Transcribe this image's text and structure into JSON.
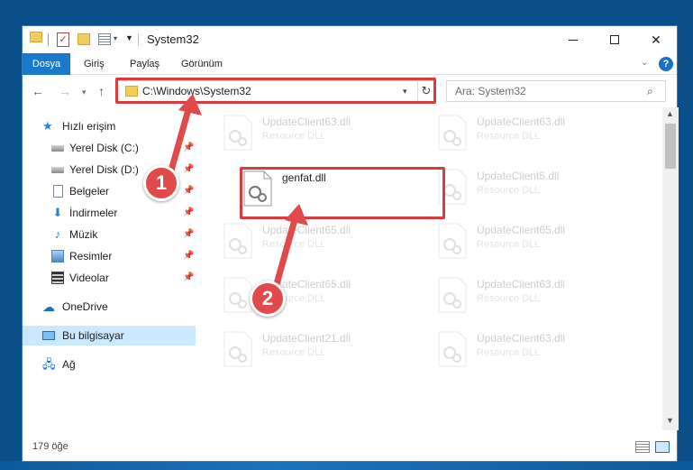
{
  "window": {
    "title": "System32",
    "controls": {
      "minimize": "minimize",
      "maximize": "maximize",
      "close": "close"
    }
  },
  "ribbon": {
    "tabs": [
      {
        "label": "Dosya",
        "active": true
      },
      {
        "label": "Giriş"
      },
      {
        "label": "Paylaş"
      },
      {
        "label": "Görünüm"
      }
    ],
    "help": "?"
  },
  "address": {
    "path": "C:\\Windows\\System32",
    "search_placeholder": "Ara: System32"
  },
  "navpane": {
    "items": [
      {
        "label": "Hızlı erişim",
        "icon": "star-icon"
      },
      {
        "label": "Yerel Disk (C:)",
        "icon": "drive-icon",
        "pinned": true
      },
      {
        "label": "Yerel Disk (D:)",
        "icon": "drive-icon",
        "pinned": true
      },
      {
        "label": "Belgeler",
        "icon": "documents-icon",
        "pinned": true
      },
      {
        "label": "İndirmeler",
        "icon": "download-icon",
        "pinned": true
      },
      {
        "label": "Müzik",
        "icon": "music-icon",
        "pinned": true
      },
      {
        "label": "Resimler",
        "icon": "pictures-icon",
        "pinned": true
      },
      {
        "label": "Videolar",
        "icon": "videos-icon",
        "pinned": true
      },
      {
        "label": "OneDrive",
        "icon": "cloud-icon"
      },
      {
        "label": "Bu bilgisayar",
        "icon": "computer-icon",
        "selected": true
      },
      {
        "label": "Ağ",
        "icon": "network-icon"
      }
    ]
  },
  "files": {
    "left": [
      {
        "name": "UpdateClient63.dll",
        "type": "Resource DLL"
      },
      {
        "name": "genfat.dll",
        "type": ""
      },
      {
        "name": "UpdateClient65.dll",
        "type": "Resource DLL"
      },
      {
        "name": "UpdateClient65.dll",
        "type": "Resource DLL"
      },
      {
        "name": "UpdateClient21.dll",
        "type": "Resource DLL"
      }
    ],
    "right": [
      {
        "name": "UpdateClient63.dll",
        "type": "Resource DLL"
      },
      {
        "name": "UpdateClient5.dll",
        "type": "Resource DLL"
      },
      {
        "name": "UpdateClient65.dll",
        "type": "Resource DLL"
      },
      {
        "name": "UpdateClient63.dll",
        "type": "Resource DLL"
      },
      {
        "name": "UpdateClient63.dll",
        "type": "Resource DLL"
      }
    ]
  },
  "status": {
    "item_count": "179 öğe"
  },
  "callouts": {
    "step1": "1",
    "step2": "2"
  },
  "colors": {
    "accent": "#1979ca",
    "highlight": "#d93c3c",
    "selected_bg": "#cce8ff"
  }
}
